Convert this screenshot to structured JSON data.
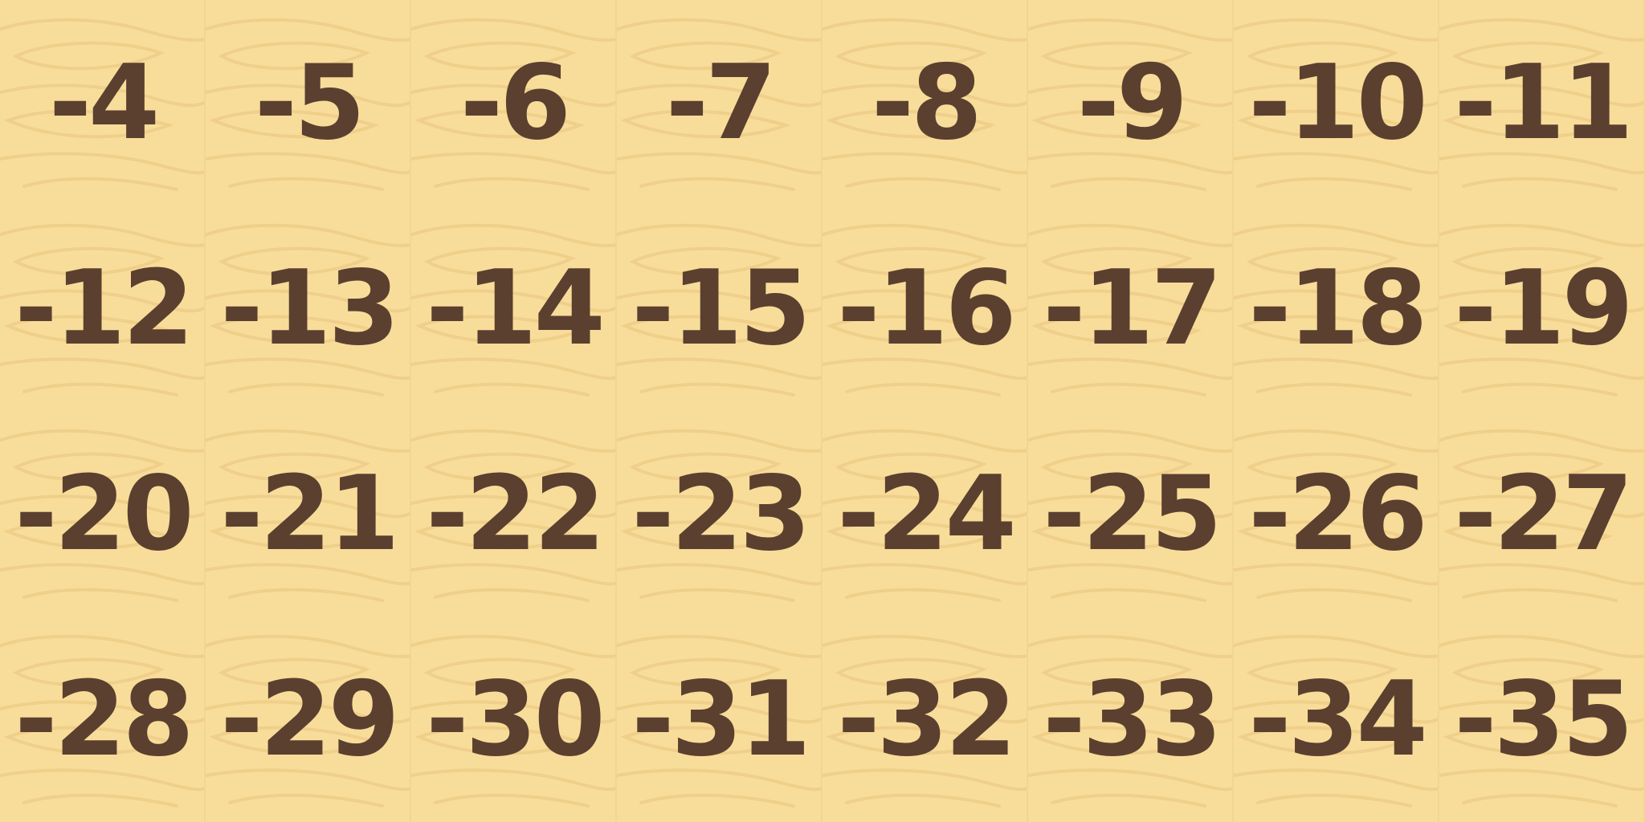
{
  "board": {
    "background_color": "#f8dd9a",
    "grain_color": "#efcf8a",
    "text_color": "#5b4030",
    "tiles": [
      "-4",
      "-5",
      "-6",
      "-7",
      "-8",
      "-9",
      "-10",
      "-11",
      "-12",
      "-13",
      "-14",
      "-15",
      "-16",
      "-17",
      "-18",
      "-19",
      "-20",
      "-21",
      "-22",
      "-23",
      "-24",
      "-25",
      "-26",
      "-27",
      "-28",
      "-29",
      "-30",
      "-31",
      "-32",
      "-33",
      "-34",
      "-35"
    ]
  }
}
